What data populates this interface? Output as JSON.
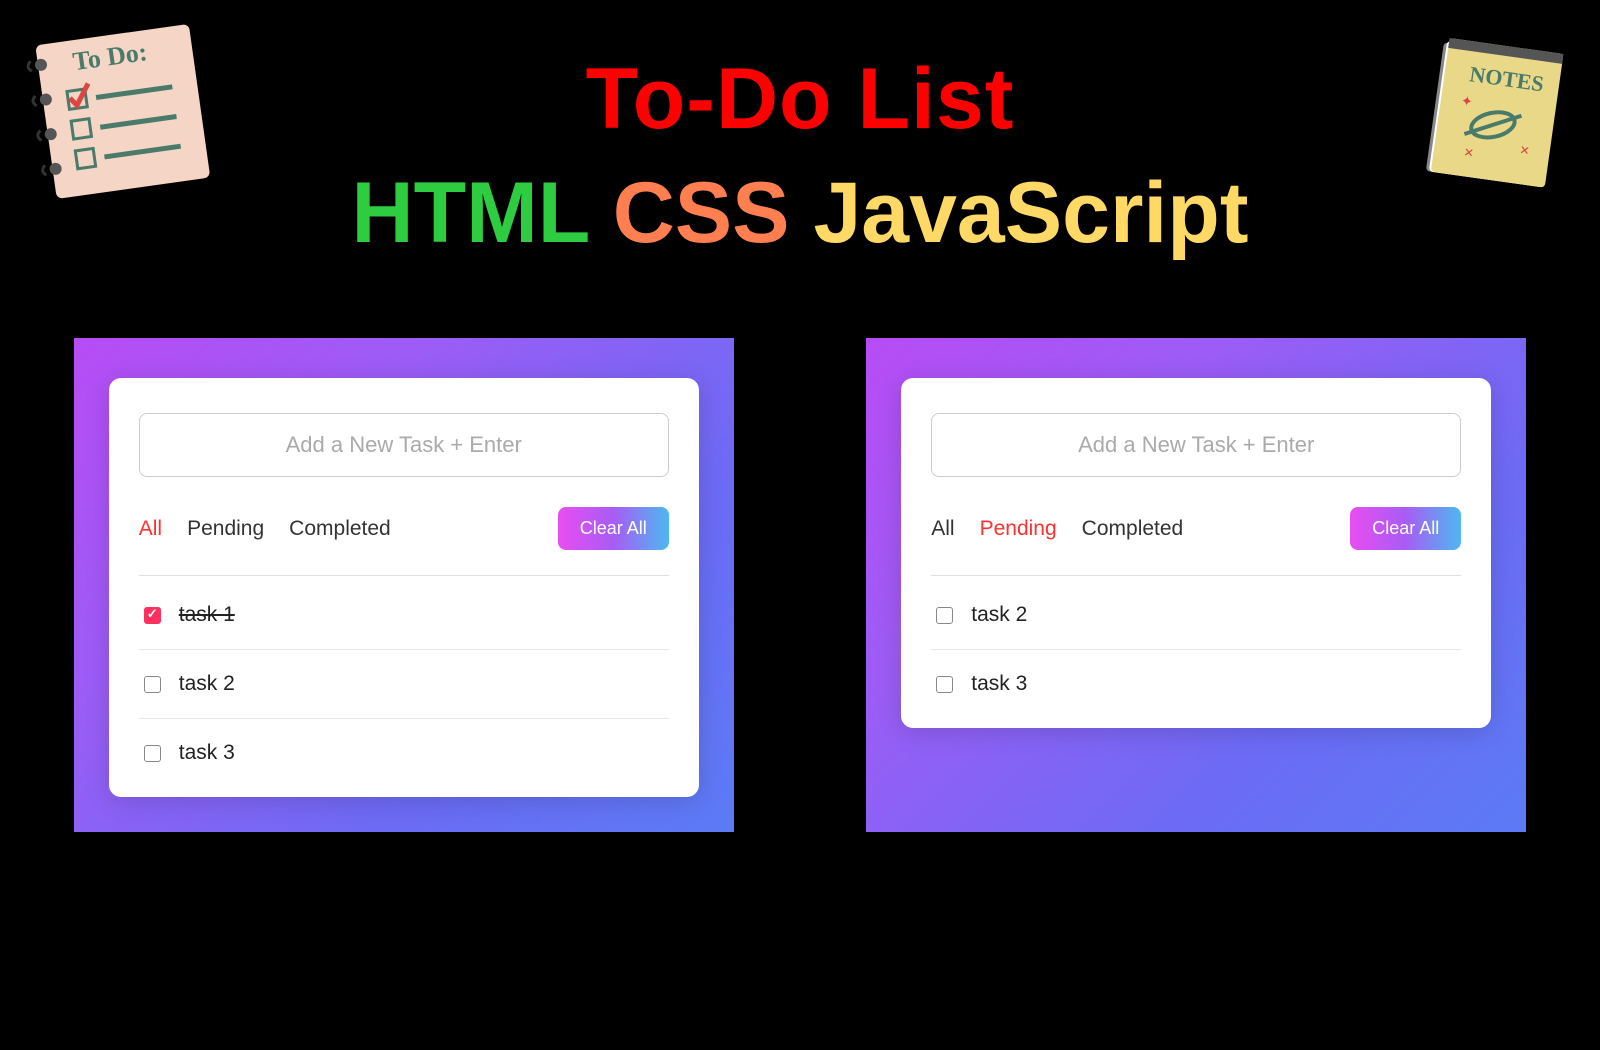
{
  "header": {
    "title": "To-Do List",
    "subtitle_html": "HTML",
    "subtitle_css": "CSS",
    "subtitle_js": "JavaScript"
  },
  "stickers": {
    "todo_label": "To Do:",
    "notes_label": "NOTES"
  },
  "panel_left": {
    "input_placeholder": "Add a New Task + Enter",
    "tabs": {
      "all": "All",
      "pending": "Pending",
      "completed": "Completed"
    },
    "active_tab": "all",
    "clear_label": "Clear All",
    "tasks": [
      {
        "label": "task 1",
        "done": true
      },
      {
        "label": "task 2",
        "done": false
      },
      {
        "label": "task 3",
        "done": false
      }
    ]
  },
  "panel_right": {
    "input_placeholder": "Add a New Task + Enter",
    "tabs": {
      "all": "All",
      "pending": "Pending",
      "completed": "Completed"
    },
    "active_tab": "pending",
    "clear_label": "Clear All",
    "tasks": [
      {
        "label": "task 2",
        "done": false
      },
      {
        "label": "task 3",
        "done": false
      }
    ]
  }
}
